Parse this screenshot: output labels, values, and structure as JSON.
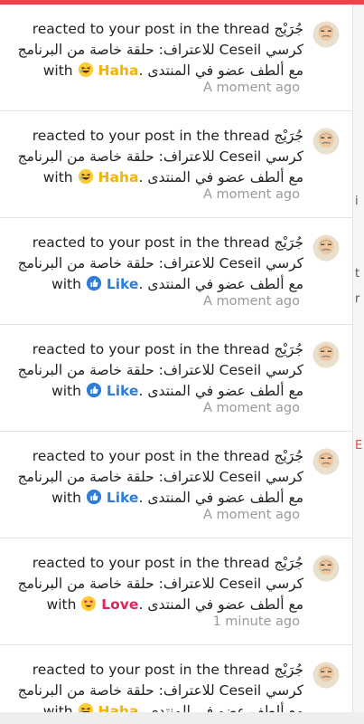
{
  "colors": {
    "top_accent": "#e04a4a",
    "like": "#2f7dd9",
    "haha": "#f4b400",
    "love": "#e0245e",
    "time": "#9a9a9a",
    "border": "#e3e3e3"
  },
  "common": {
    "username": "جُرَيْج",
    "action": "reacted to your post in the thread",
    "thread_part1": "كرسي",
    "thread_part2": "Ceseil",
    "thread_part3": "للاعتراف: حلقة خاصة من البرنامج مع ألطف عضو في المنتدى",
    "with": "with",
    "period": "."
  },
  "notifications": [
    {
      "reaction": "Haha",
      "reaction_icon": "haha-emoji-icon",
      "time": "A moment ago"
    },
    {
      "reaction": "Haha",
      "reaction_icon": "haha-emoji-icon",
      "time": "A moment ago"
    },
    {
      "reaction": "Like",
      "reaction_icon": "like-thumb-icon",
      "time": "A moment ago"
    },
    {
      "reaction": "Like",
      "reaction_icon": "like-thumb-icon",
      "time": "A moment ago"
    },
    {
      "reaction": "Like",
      "reaction_icon": "like-thumb-icon",
      "time": "A moment ago"
    },
    {
      "reaction": "Love",
      "reaction_icon": "love-heart-eyes-icon",
      "time": "1 minute ago"
    },
    {
      "reaction": "Haha",
      "reaction_icon": "haha-emoji-icon",
      "time": ""
    }
  ],
  "page_edge": {
    "glyphs": [
      "i",
      "t",
      "r",
      "E"
    ]
  }
}
